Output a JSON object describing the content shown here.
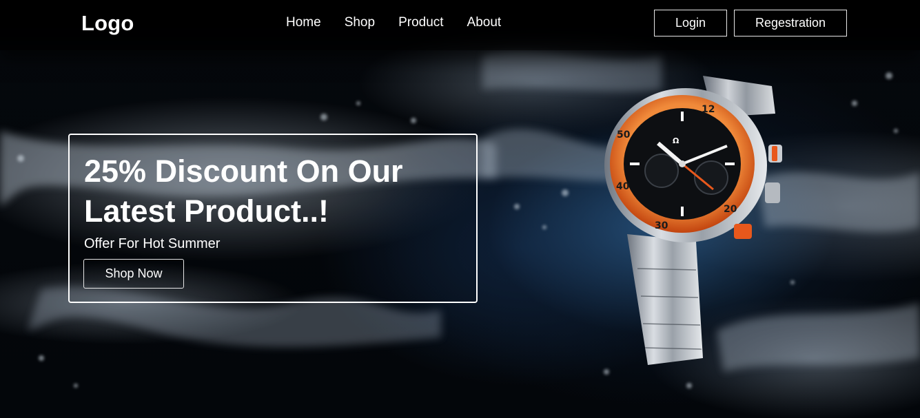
{
  "nav": {
    "logo": "Logo",
    "links": [
      "Home",
      "Shop",
      "Product",
      "About"
    ],
    "login_label": "Login",
    "register_label": "Regestration"
  },
  "hero": {
    "title": "25% Discount On Our Latest Product..!",
    "subtitle": "Offer For Hot Summer",
    "cta_label": "Shop Now",
    "product_image": "wristwatch-water-splash"
  },
  "colors": {
    "accent": "#e8581c",
    "background": "#03060a",
    "text": "#ffffff"
  }
}
